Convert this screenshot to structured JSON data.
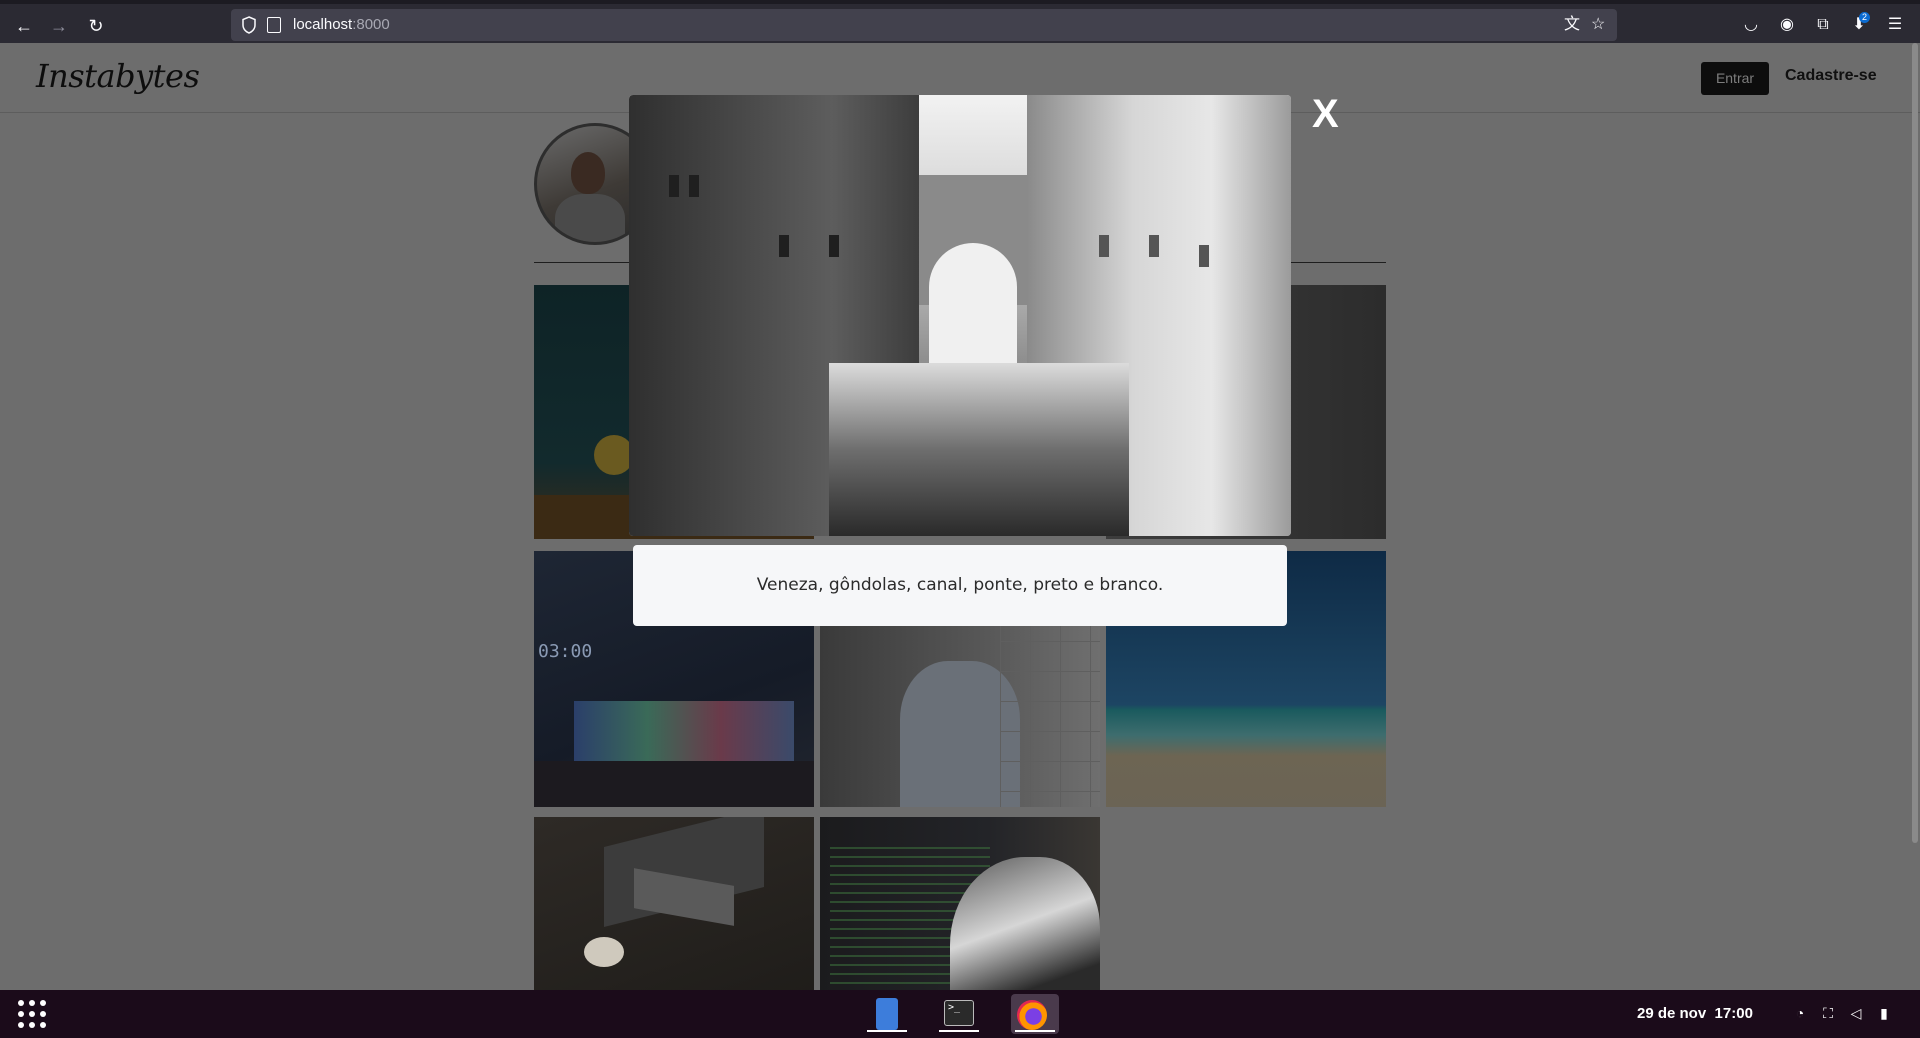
{
  "browser": {
    "url_host": "localhost",
    "url_port": ":8000"
  },
  "site": {
    "logo": "Instabytes",
    "login_label": "Entrar",
    "signup_label": "Cadastre-se"
  },
  "modal": {
    "close_label": "X",
    "caption": "Veneza, gôndolas, canal, ponte, preto e branco."
  },
  "taskbar": {
    "date": "29 de nov",
    "time": "17:00",
    "extensions_badge": "2"
  }
}
